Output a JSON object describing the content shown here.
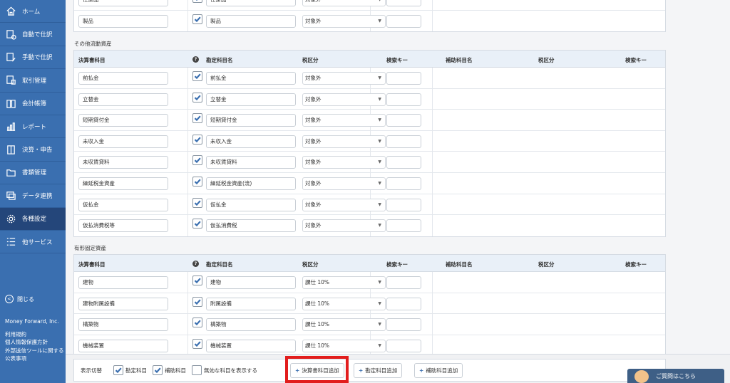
{
  "sidebar": {
    "items": [
      {
        "label": "ホーム",
        "icon": "home-icon"
      },
      {
        "label": "自動で仕訳",
        "icon": "auto-journal-icon"
      },
      {
        "label": "手動で仕訳",
        "icon": "manual-journal-icon"
      },
      {
        "label": "取引管理",
        "icon": "transaction-icon"
      },
      {
        "label": "会計帳簿",
        "icon": "ledger-book-icon"
      },
      {
        "label": "レポート",
        "icon": "report-chart-icon"
      },
      {
        "label": "決算・申告",
        "icon": "settlement-icon"
      },
      {
        "label": "書類管理",
        "icon": "folder-icon"
      },
      {
        "label": "データ連携",
        "icon": "data-link-icon"
      },
      {
        "label": "各種設定",
        "icon": "gear-icon",
        "active": true
      },
      {
        "label": "他サービス",
        "icon": "list-icon"
      }
    ],
    "close_label": "閉じる",
    "company": "Money Forward, Inc.",
    "links": [
      "利用規約",
      "個人情報保護方針",
      "外部送信ツールに関する公表事項"
    ]
  },
  "top_section": {
    "rows": [
      {
        "fs": "仕掛品",
        "name": "仕掛品",
        "tax": "対象外",
        "checked": true
      },
      {
        "fs": "製品",
        "name": "製品",
        "tax": "対象外",
        "checked": true
      }
    ]
  },
  "headers": {
    "fs_name": "決算書科目",
    "help_icon": "?",
    "account_name": "勘定科目名",
    "tax": "税区分",
    "search_key": "検索キー",
    "sub_account": "補助科目名",
    "sub_tax": "税区分",
    "sub_search_key": "検索キー"
  },
  "other_current": {
    "title": "その他流動資産",
    "rows": [
      {
        "fs": "前払金",
        "name": "前払金",
        "tax": "対象外",
        "checked": true
      },
      {
        "fs": "立替金",
        "name": "立替金",
        "tax": "対象外",
        "checked": true
      },
      {
        "fs": "短期貸付金",
        "name": "短期貸付金",
        "tax": "対象外",
        "checked": true
      },
      {
        "fs": "未収入金",
        "name": "未収入金",
        "tax": "対象外",
        "checked": true
      },
      {
        "fs": "未収賃貸料",
        "name": "未収賃貸料",
        "tax": "対象外",
        "checked": true
      },
      {
        "fs": "繰延税金資産",
        "name": "繰延税金資産(流)",
        "tax": "対象外",
        "checked": true
      },
      {
        "fs": "仮払金",
        "name": "仮払金",
        "tax": "対象外",
        "checked": true
      },
      {
        "fs": "仮払消費税等",
        "name": "仮払消費税",
        "tax": "対象外",
        "checked": true
      }
    ]
  },
  "tangible": {
    "title": "有形固定資産",
    "rows": [
      {
        "fs": "建物",
        "name": "建物",
        "tax": "課仕 10%",
        "checked": true
      },
      {
        "fs": "建物附属設備",
        "name": "附属設備",
        "tax": "課仕 10%",
        "checked": true
      },
      {
        "fs": "構築物",
        "name": "構築物",
        "tax": "課仕 10%",
        "checked": true
      },
      {
        "fs": "機械装置",
        "name": "機械装置",
        "tax": "課仕 10%",
        "checked": true
      }
    ]
  },
  "bottom_bar": {
    "toggle_label": "表示切替",
    "check_account": "勘定科目",
    "check_sub": "補助科目",
    "check_invalid": "無効な科目を表示する",
    "add_fs": "決算書科目追加",
    "add_account": "勘定科目追加",
    "add_sub": "補助科目追加",
    "plus": "+"
  },
  "help_button": "ご質問はこちら",
  "colors": {
    "sidebar": "#3a6fb0",
    "highlight": "#e21d1d"
  }
}
